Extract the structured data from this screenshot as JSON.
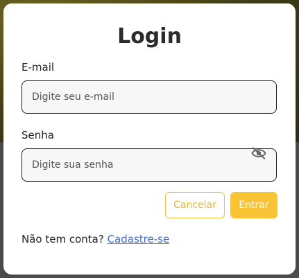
{
  "login": {
    "title": "Login",
    "email": {
      "label": "E-mail",
      "value": "",
      "placeholder": "Digite seu e-mail"
    },
    "password": {
      "label": "Senha",
      "value": "",
      "placeholder": "Digite sua senha",
      "toggle_icon": "eye-slash-icon"
    },
    "buttons": {
      "cancel_label": "Cancelar",
      "submit_label": "Entrar"
    },
    "signup": {
      "prompt": "Não tem conta?",
      "link_label": "Cadastre-se"
    }
  },
  "colors": {
    "accent": "#f9c433",
    "link": "#3b6fd8"
  }
}
